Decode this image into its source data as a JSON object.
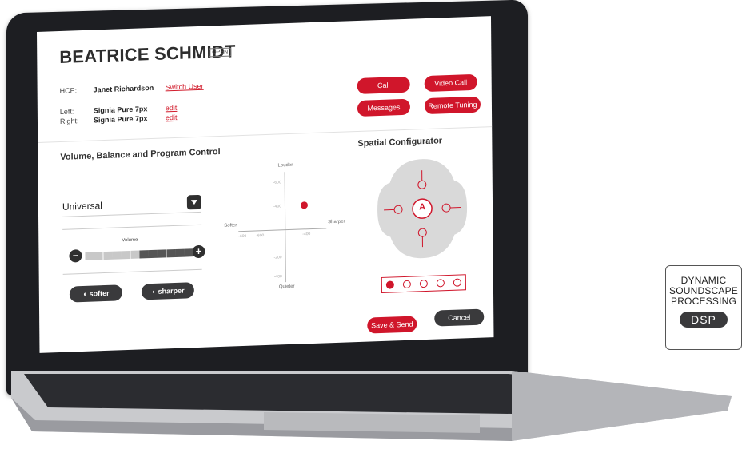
{
  "patient": {
    "name": "BEATRICE SCHMIDT",
    "status": "OPEN"
  },
  "hcp": {
    "label": "HCP:",
    "name": "Janet Richardson",
    "switch_link": "Switch User"
  },
  "devices": {
    "left_label": "Left:",
    "left_model": "Signia Pure 7px",
    "left_edit": "edit",
    "right_label": "Right:",
    "right_model": "Signia Pure 7px",
    "right_edit": "edit"
  },
  "actions": {
    "call": "Call",
    "video_call": "Video Call",
    "messages": "Messages",
    "remote_tuning": "Remote Tuning"
  },
  "volume_section": {
    "title": "Volume, Balance and Program Control",
    "program": "Universal",
    "volume_label": "Volume",
    "volume_level": 0.5,
    "softer": "softer",
    "sharper": "sharper"
  },
  "balance": {
    "loud": "Louder",
    "quiet": "Quieter",
    "soft": "Softer",
    "sharp": "Sharper",
    "ticks": [
      "-600",
      "-400",
      "-200",
      "-400",
      "-600",
      "-600",
      "-400"
    ]
  },
  "spatial": {
    "title": "Spatial Configurator",
    "center": "A"
  },
  "footer": {
    "save": "Save & Send",
    "cancel": "Cancel"
  },
  "badge": {
    "line1": "DYNAMIC",
    "line2": "SOUNDSCAPE",
    "line3": "PROCESSING",
    "pill": "DSP"
  },
  "colors": {
    "accent": "#d0162b",
    "dark": "#3a3a3c",
    "frame": "#1d1e22"
  }
}
